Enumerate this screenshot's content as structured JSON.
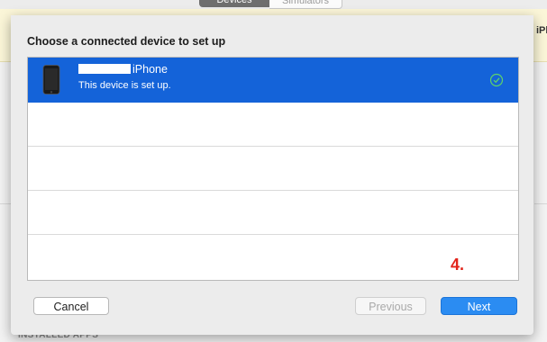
{
  "background": {
    "tabs": [
      "Devices",
      "Simulators"
    ],
    "right_text": "iPh",
    "section_label": "INSTALLED APPS"
  },
  "sheet": {
    "title": "Choose a connected device to set up",
    "devices": [
      {
        "name": "iPhone",
        "status": "This device is set up.",
        "selected": true,
        "set_up": true
      }
    ],
    "empty_rows": 4,
    "annotation": "4.",
    "buttons": {
      "cancel": "Cancel",
      "previous": "Previous",
      "next": "Next"
    }
  },
  "colors": {
    "selection": "#1463d9",
    "primary_button": "#2b8cf2",
    "annotation": "#e2231a"
  }
}
